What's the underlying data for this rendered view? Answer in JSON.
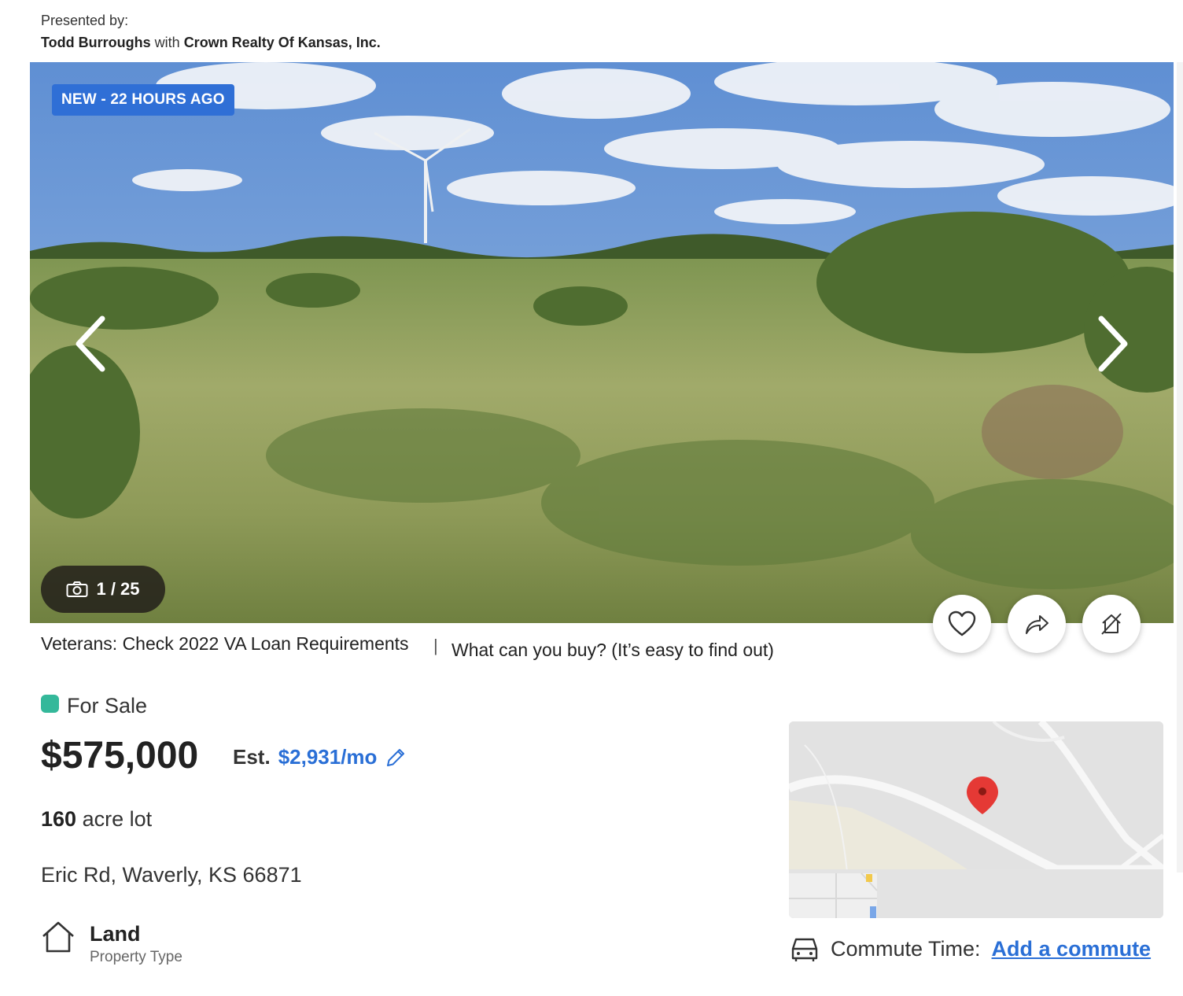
{
  "presented": {
    "label": "Presented by:",
    "agent": "Todd Burroughs",
    "with": "with",
    "brokerage": "Crown Realty Of Kansas, Inc."
  },
  "gallery": {
    "badge": "NEW - 22 HOURS AGO",
    "counter": "1 / 25"
  },
  "links": {
    "va_loan": "Veterans: Check 2022 VA Loan Requirements",
    "separator": "|",
    "buy_power": "What can you buy? (It’s easy to find out)"
  },
  "listing": {
    "status": "For Sale",
    "status_color": "#34b89a",
    "price": "$575,000",
    "est_label": "Est.",
    "est_payment": "$2,931/mo",
    "lot_size": "160",
    "lot_unit": "acre lot",
    "address": "Eric Rd, Waverly, KS 66871",
    "property_type": "Land",
    "property_type_label": "Property Type"
  },
  "commute": {
    "label": "Commute Time:",
    "link": "Add a commute"
  },
  "colors": {
    "accent": "#2a6fd6",
    "badge_bg": "#2f6fd6"
  }
}
